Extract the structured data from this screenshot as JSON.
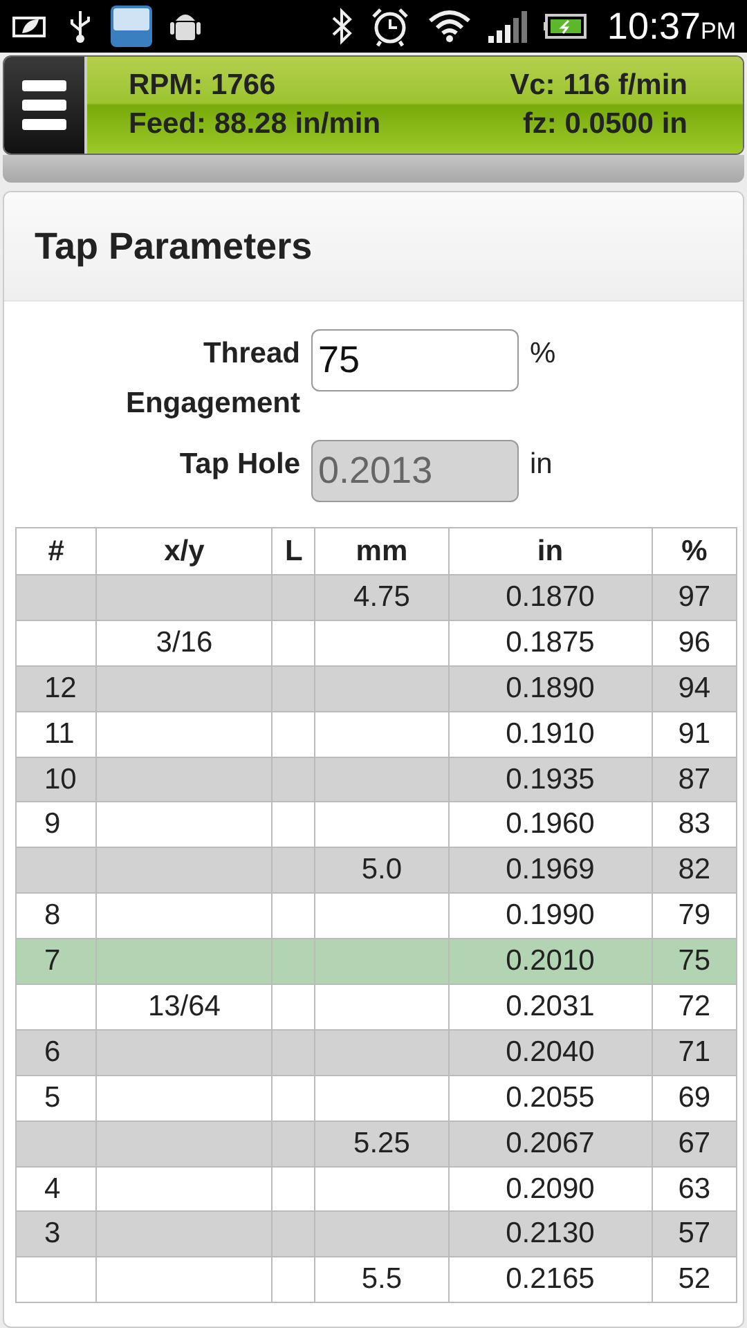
{
  "status_bar": {
    "time": "10:37",
    "ampm": "PM"
  },
  "header": {
    "rpm": "RPM: 1766",
    "vc": "Vc: 116 f/min",
    "feed": "Feed: 88.28 in/min",
    "fz": "fz: 0.0500 in"
  },
  "card": {
    "title": "Tap Parameters",
    "fields": [
      {
        "kind": "input",
        "label": "Thread Engagement",
        "value": "75",
        "unit": "%",
        "disabled": false
      },
      {
        "kind": "input",
        "label": "Tap Hole",
        "value": "0.2013",
        "unit": "in",
        "disabled": true
      }
    ]
  },
  "table": {
    "columns": [
      "#",
      "x/y",
      "L",
      "mm",
      "in",
      "%"
    ],
    "rows": [
      {
        "cells": [
          "",
          "",
          "",
          "4.75",
          "0.1870",
          "97"
        ],
        "selected": false
      },
      {
        "cells": [
          "",
          "3/16",
          "",
          "",
          "0.1875",
          "96"
        ],
        "selected": false
      },
      {
        "cells": [
          "12",
          "",
          "",
          "",
          "0.1890",
          "94"
        ],
        "selected": false
      },
      {
        "cells": [
          "11",
          "",
          "",
          "",
          "0.1910",
          "91"
        ],
        "selected": false
      },
      {
        "cells": [
          "10",
          "",
          "",
          "",
          "0.1935",
          "87"
        ],
        "selected": false
      },
      {
        "cells": [
          "9",
          "",
          "",
          "",
          "0.1960",
          "83"
        ],
        "selected": false
      },
      {
        "cells": [
          "",
          "",
          "",
          "5.0",
          "0.1969",
          "82"
        ],
        "selected": false
      },
      {
        "cells": [
          "8",
          "",
          "",
          "",
          "0.1990",
          "79"
        ],
        "selected": false
      },
      {
        "cells": [
          "7",
          "",
          "",
          "",
          "0.2010",
          "75"
        ],
        "selected": true
      },
      {
        "cells": [
          "",
          "13/64",
          "",
          "",
          "0.2031",
          "72"
        ],
        "selected": false
      },
      {
        "cells": [
          "6",
          "",
          "",
          "",
          "0.2040",
          "71"
        ],
        "selected": false
      },
      {
        "cells": [
          "5",
          "",
          "",
          "",
          "0.2055",
          "69"
        ],
        "selected": false
      },
      {
        "cells": [
          "",
          "",
          "",
          "5.25",
          "0.2067",
          "67"
        ],
        "selected": false
      },
      {
        "cells": [
          "4",
          "",
          "",
          "",
          "0.2090",
          "63"
        ],
        "selected": false
      },
      {
        "cells": [
          "3",
          "",
          "",
          "",
          "0.2130",
          "57"
        ],
        "selected": false
      },
      {
        "cells": [
          "",
          "",
          "",
          "5.5",
          "0.2165",
          "52"
        ],
        "selected": false
      }
    ]
  }
}
